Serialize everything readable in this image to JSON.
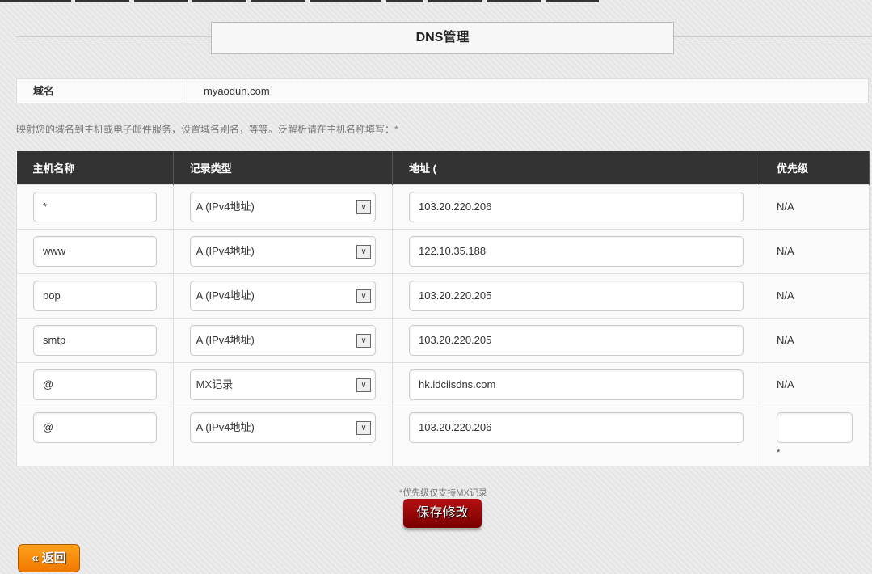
{
  "page": {
    "title": "DNS管理"
  },
  "domain": {
    "label": "域名",
    "value": "myaodun.com"
  },
  "description": "映射您的域名到主机或电子邮件服务，设置域名别名，等等。泛解析请在主机名称填写：*",
  "table": {
    "headers": [
      "主机名称",
      "记录类型",
      "地址 (",
      "优先级"
    ],
    "rows": [
      {
        "host": "*",
        "type": "A (IPv4地址)",
        "address": "103.20.220.206",
        "priority": "N/A"
      },
      {
        "host": "www",
        "type": "A (IPv4地址)",
        "address": "122.10.35.188",
        "priority": "N/A"
      },
      {
        "host": "pop",
        "type": "A (IPv4地址)",
        "address": "103.20.220.205",
        "priority": "N/A"
      },
      {
        "host": "smtp",
        "type": "A (IPv4地址)",
        "address": "103.20.220.205",
        "priority": "N/A"
      },
      {
        "host": "@",
        "type": "MX记录",
        "address": "hk.idciisdns.com",
        "priority": "N/A"
      }
    ],
    "new_row": {
      "host": "@",
      "type": "A (IPv4地址)",
      "address": "103.20.220.206",
      "priority": "",
      "priority_mark": "*"
    }
  },
  "priority_note": "*优先级仅支持MX记录",
  "save_label": "保存修改",
  "back_label": "« 返回"
}
